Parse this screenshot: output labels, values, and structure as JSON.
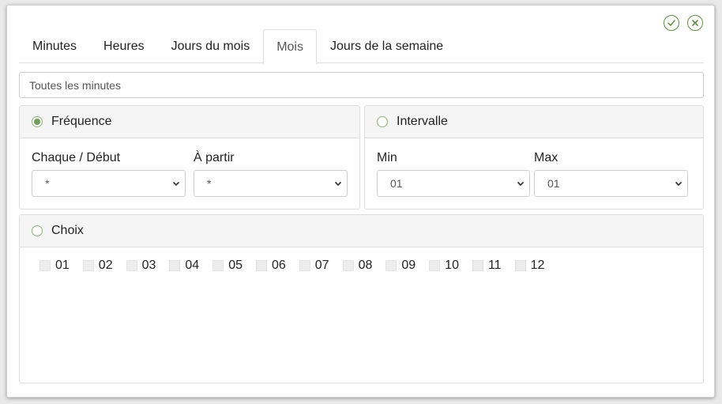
{
  "tabs": [
    {
      "label": "Minutes"
    },
    {
      "label": "Heures"
    },
    {
      "label": "Jours du mois"
    },
    {
      "label": "Mois"
    },
    {
      "label": "Jours de la semaine"
    }
  ],
  "summary": "Toutes les minutes",
  "frequency": {
    "title": "Fréquence",
    "every_label": "Chaque / Début",
    "every_value": "*",
    "from_label": "À partir",
    "from_value": "*"
  },
  "interval": {
    "title": "Intervalle",
    "min_label": "Min",
    "min_value": "01",
    "max_label": "Max",
    "max_value": "01"
  },
  "choice": {
    "title": "Choix",
    "items": [
      "01",
      "02",
      "03",
      "04",
      "05",
      "06",
      "07",
      "08",
      "09",
      "10",
      "11",
      "12"
    ]
  },
  "colors": {
    "accent": "#6f9e58"
  },
  "icons": {
    "confirm": "check-icon",
    "close": "close-icon"
  }
}
